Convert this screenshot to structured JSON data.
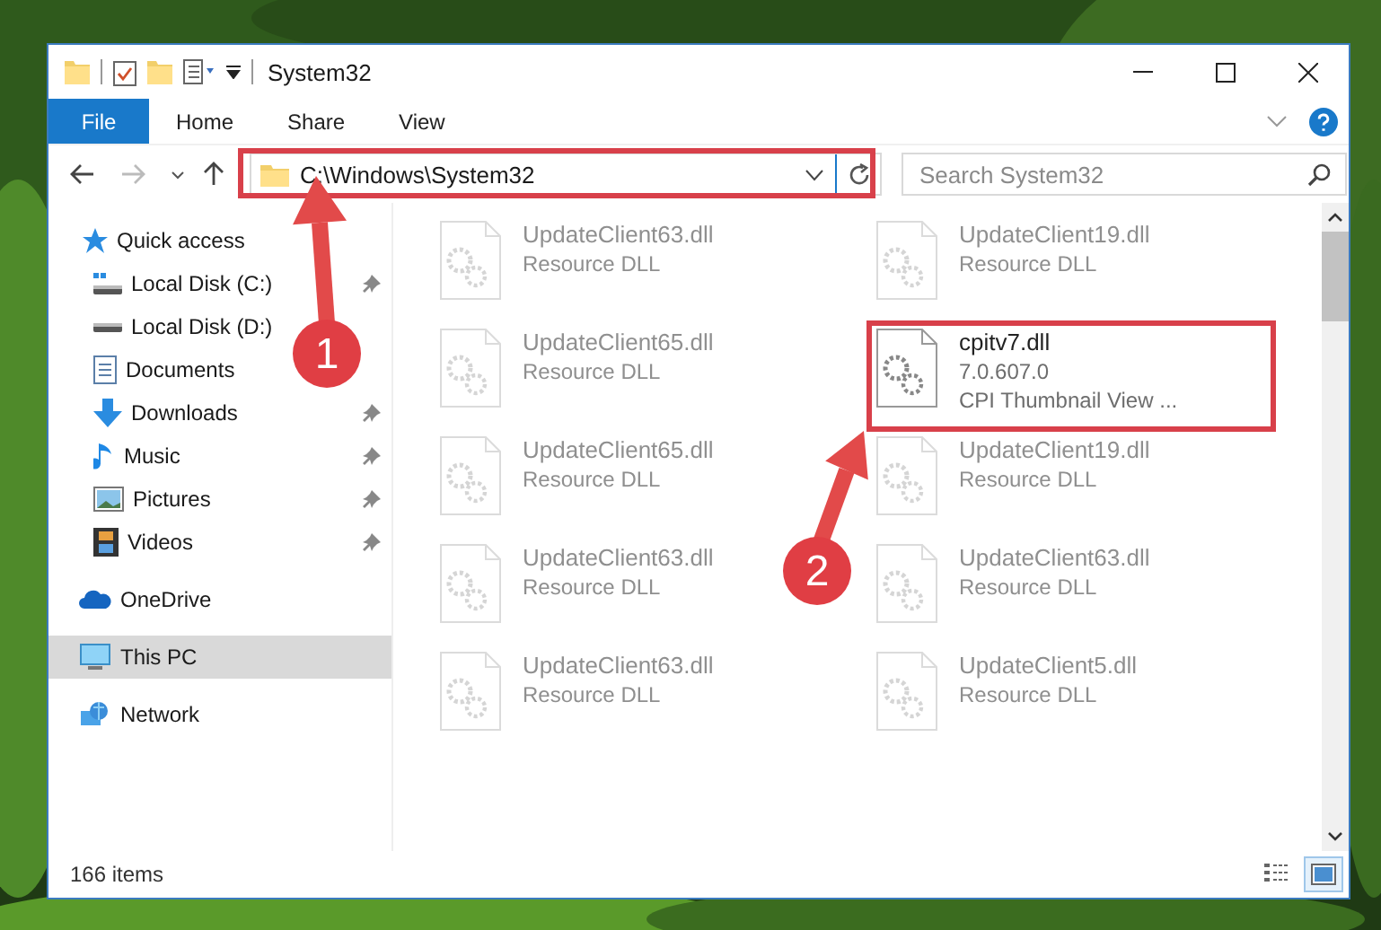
{
  "window": {
    "title": "System32",
    "ribbon_tabs": [
      {
        "label": "File",
        "kind": "file",
        "selected": false
      },
      {
        "label": "Home",
        "kind": "tab",
        "selected": false
      },
      {
        "label": "Share",
        "kind": "tab",
        "selected": false
      },
      {
        "label": "View",
        "kind": "tab",
        "selected": false
      }
    ],
    "address": {
      "path": "C:\\Windows\\System32"
    },
    "search": {
      "placeholder": "Search System32"
    },
    "sidebar": {
      "items": [
        {
          "label": "Quick access",
          "selected": false,
          "children": [
            {
              "label": "Local Disk (C:)",
              "pinned": true,
              "selected": false
            },
            {
              "label": "Local Disk (D:)",
              "pinned": false,
              "selected": false
            },
            {
              "label": "Documents",
              "pinned": false,
              "selected": false
            },
            {
              "label": "Downloads",
              "pinned": true,
              "selected": false
            },
            {
              "label": "Music",
              "pinned": true,
              "selected": false
            },
            {
              "label": "Pictures",
              "pinned": true,
              "selected": false
            },
            {
              "label": "Videos",
              "pinned": true,
              "selected": false
            }
          ]
        },
        {
          "label": "OneDrive",
          "selected": false
        },
        {
          "label": "This PC",
          "selected": true
        },
        {
          "label": "Network",
          "selected": false
        }
      ]
    },
    "files": [
      {
        "name": "UpdateClient63.dll",
        "details": [
          "Resource DLL"
        ],
        "blurred": true
      },
      {
        "name": "UpdateClient19.dll",
        "details": [
          "Resource DLL"
        ],
        "blurred": true
      },
      {
        "name": "UpdateClient65.dll",
        "details": [
          "Resource DLL"
        ],
        "blurred": true
      },
      {
        "name": "cpitv7.dll",
        "details": [
          "7.0.607.0",
          "CPI Thumbnail View ..."
        ],
        "blurred": false
      },
      {
        "name": "UpdateClient65.dll",
        "details": [
          "Resource DLL"
        ],
        "blurred": true
      },
      {
        "name": "UpdateClient19.dll",
        "details": [
          "Resource DLL"
        ],
        "blurred": true
      },
      {
        "name": "UpdateClient63.dll",
        "details": [
          "Resource DLL"
        ],
        "blurred": true
      },
      {
        "name": "UpdateClient63.dll",
        "details": [
          "Resource DLL"
        ],
        "blurred": true
      },
      {
        "name": "UpdateClient63.dll",
        "details": [
          "Resource DLL"
        ],
        "blurred": true
      },
      {
        "name": "UpdateClient5.dll",
        "details": [
          "Resource DLL"
        ],
        "blurred": true
      }
    ],
    "status_bar": "166 items",
    "view_buttons": [
      {
        "selected": false
      },
      {
        "selected": true
      }
    ]
  },
  "annotations": [
    {
      "number": "1"
    },
    {
      "number": "2"
    }
  ]
}
